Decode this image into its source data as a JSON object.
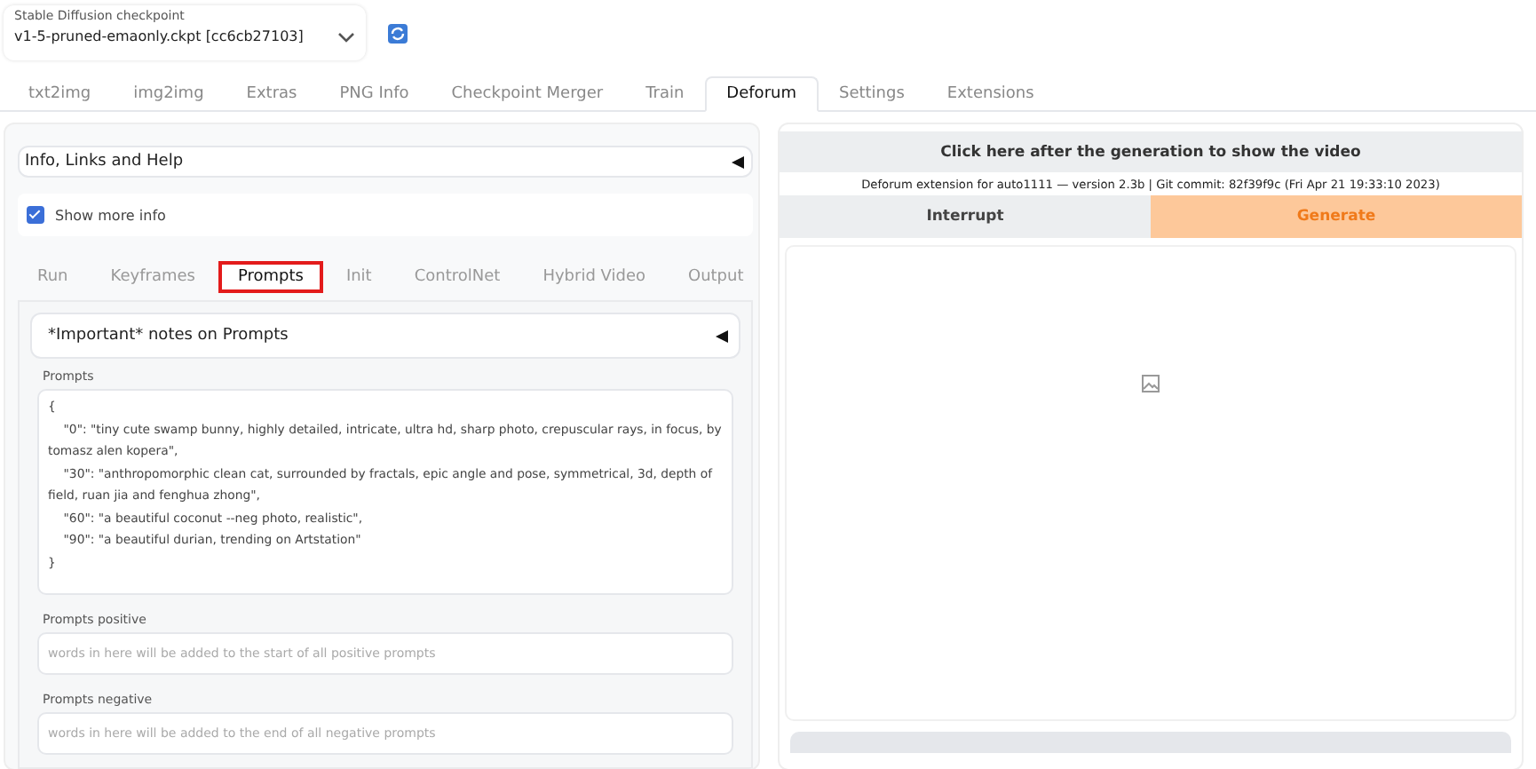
{
  "checkpoint": {
    "label": "Stable Diffusion checkpoint",
    "value": "v1-5-pruned-emaonly.ckpt [cc6cb27103]"
  },
  "tabs": [
    {
      "label": "txt2img",
      "selected": false
    },
    {
      "label": "img2img",
      "selected": false
    },
    {
      "label": "Extras",
      "selected": false
    },
    {
      "label": "PNG Info",
      "selected": false
    },
    {
      "label": "Checkpoint Merger",
      "selected": false
    },
    {
      "label": "Train",
      "selected": false
    },
    {
      "label": "Deforum",
      "selected": true
    },
    {
      "label": "Settings",
      "selected": false
    },
    {
      "label": "Extensions",
      "selected": false
    }
  ],
  "info_accordion": {
    "title": "Info, Links and Help",
    "expanded": false
  },
  "show_more_info": {
    "label": "Show more info",
    "checked": true
  },
  "subtabs": [
    {
      "label": "Run",
      "selected": false,
      "highlighted": false
    },
    {
      "label": "Keyframes",
      "selected": false,
      "highlighted": false
    },
    {
      "label": "Prompts",
      "selected": true,
      "highlighted": true
    },
    {
      "label": "Init",
      "selected": false,
      "highlighted": false
    },
    {
      "label": "ControlNet",
      "selected": false,
      "highlighted": false
    },
    {
      "label": "Hybrid Video",
      "selected": false,
      "highlighted": false
    },
    {
      "label": "Output",
      "selected": false,
      "highlighted": false
    }
  ],
  "notes_accordion": {
    "title": "*Important* notes on Prompts",
    "expanded": false
  },
  "prompts": {
    "label": "Prompts",
    "value": "{\n    \"0\": \"tiny cute swamp bunny, highly detailed, intricate, ultra hd, sharp photo, crepuscular rays, in focus, by tomasz alen kopera\",\n    \"30\": \"anthropomorphic clean cat, surrounded by fractals, epic angle and pose, symmetrical, 3d, depth of field, ruan jia and fenghua zhong\",\n    \"60\": \"a beautiful coconut --neg photo, realistic\",\n    \"90\": \"a beautiful durian, trending on Artstation\"\n}"
  },
  "prompts_positive": {
    "label": "Prompts positive",
    "placeholder": "words in here will be added to the start of all positive prompts"
  },
  "prompts_negative": {
    "label": "Prompts negative",
    "placeholder": "words in here will be added to the end of all negative prompts"
  },
  "video_button": "Click here after the generation to show the video",
  "version_info": "Deforum extension for auto1111 — version 2.3b | Git commit: 82f39f9c (Fri Apr 21 19:33:10 2023)",
  "interrupt_button": "Interrupt",
  "generate_button": "Generate"
}
